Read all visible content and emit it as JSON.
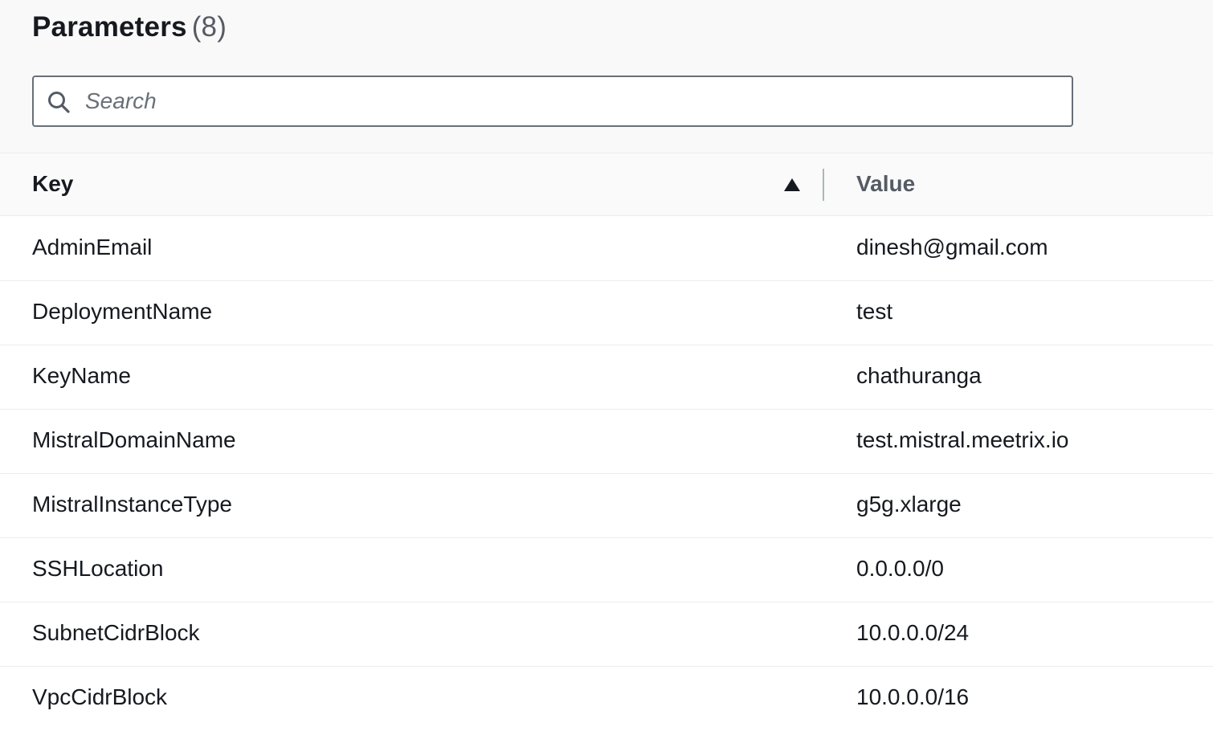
{
  "panel": {
    "title": "Parameters",
    "count": "(8)"
  },
  "search": {
    "placeholder": "Search",
    "value": "",
    "icon": "search-icon"
  },
  "table": {
    "columns": [
      {
        "label": "Key",
        "sort": "ascending",
        "sort_icon": "sort-ascending-icon"
      },
      {
        "label": "Value"
      }
    ],
    "rows": [
      {
        "key": "AdminEmail",
        "value": "dinesh@gmail.com"
      },
      {
        "key": "DeploymentName",
        "value": "test"
      },
      {
        "key": "KeyName",
        "value": "chathuranga"
      },
      {
        "key": "MistralDomainName",
        "value": "test.mistral.meetrix.io"
      },
      {
        "key": "MistralInstanceType",
        "value": "g5g.xlarge"
      },
      {
        "key": "SSHLocation",
        "value": "0.0.0.0/0"
      },
      {
        "key": "SubnetCidrBlock",
        "value": "10.0.0.0/24"
      },
      {
        "key": "VpcCidrBlock",
        "value": "10.0.0.0/16"
      }
    ]
  },
  "colors": {
    "header_background": "#f9f9f9",
    "text_primary": "#16191f",
    "text_secondary": "#545b64",
    "border": "#eaeded",
    "input_border": "#687078"
  }
}
